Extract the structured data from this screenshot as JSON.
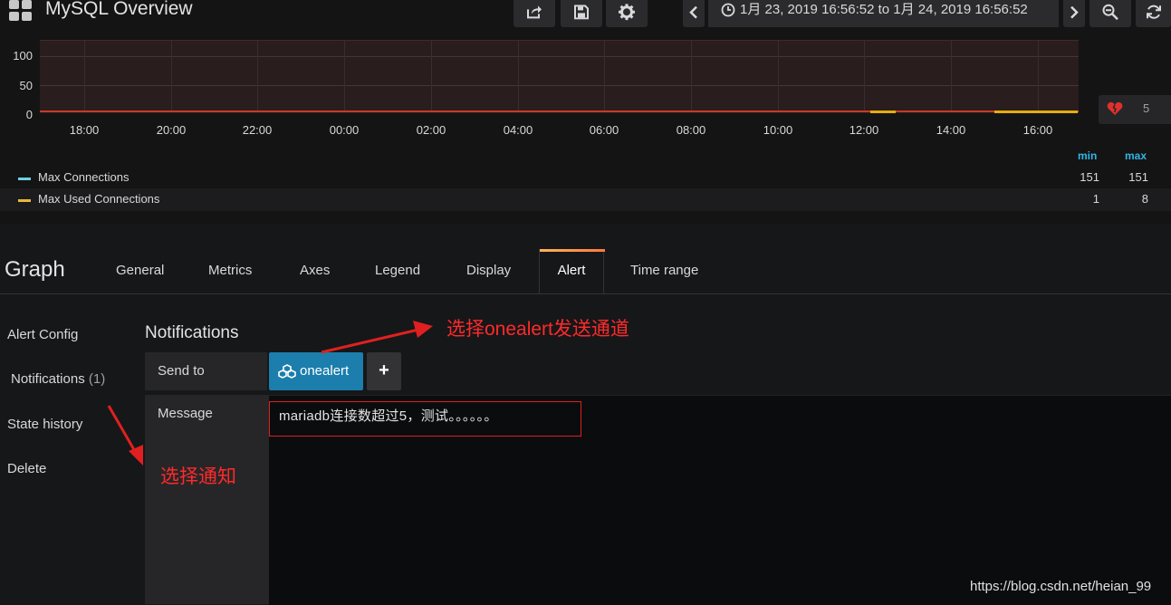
{
  "navbar": {
    "title": "MySQL Overview",
    "time_range": "1月 23, 2019 16:56:52 to 1月 24, 2019 16:56:52",
    "icons": [
      "dashboard-logo-icon",
      "share-icon",
      "save-icon",
      "settings-icon",
      "chevron-left-icon",
      "clock-icon",
      "chevron-right-icon",
      "zoom-out-icon",
      "refresh-icon"
    ]
  },
  "graph": {
    "y_ticks": [
      "100",
      "50",
      "0"
    ],
    "x_ticks": [
      "18:00",
      "20:00",
      "22:00",
      "00:00",
      "02:00",
      "04:00",
      "06:00",
      "08:00",
      "10:00",
      "12:00",
      "14:00",
      "16:00"
    ],
    "alert_value": "5",
    "threshold_color": "#c93a24",
    "legend_headers": {
      "min": "min",
      "max": "max"
    },
    "legend": [
      {
        "name": "Max Connections",
        "color": "#6ed0e0",
        "min": "151",
        "max": "151"
      },
      {
        "name": "Max Used Connections",
        "color": "#eab839",
        "min": "1",
        "max": "8"
      }
    ]
  },
  "chart_data": {
    "type": "line",
    "x": [
      "18:00",
      "20:00",
      "22:00",
      "00:00",
      "02:00",
      "04:00",
      "06:00",
      "08:00",
      "10:00",
      "12:00",
      "14:00",
      "16:00"
    ],
    "ylim": [
      0,
      100
    ],
    "series": [
      {
        "name": "Max Connections",
        "values": [
          151,
          151,
          151,
          151,
          151,
          151,
          151,
          151,
          151,
          151,
          151,
          151
        ]
      },
      {
        "name": "Max Used Connections",
        "values": [
          1,
          1,
          1,
          1,
          1,
          1,
          1,
          1,
          1,
          1,
          1,
          8
        ]
      }
    ]
  },
  "editor": {
    "title": "Graph",
    "tabs": [
      "General",
      "Metrics",
      "Axes",
      "Legend",
      "Display",
      "Alert",
      "Time range"
    ],
    "active_tab": "Alert"
  },
  "sidebar": {
    "items": [
      {
        "label": "Alert Config"
      },
      {
        "label": "Notifications",
        "count": "(1)"
      },
      {
        "label": "State history"
      },
      {
        "label": "Delete"
      }
    ]
  },
  "notifications": {
    "title": "Notifications",
    "send_to_label": "Send to",
    "channel": "onealert",
    "add_label": "+",
    "message_label": "Message",
    "message": "mariadb连接数超过5，测试。。。。。。"
  },
  "annotations": {
    "select_channel": "选择onealert发送通道",
    "select_notification": "选择通知"
  },
  "watermark": "https://blog.csdn.net/heian_99",
  "colors": {
    "accent": "#1b7eac",
    "annotation": "#ff2a2a",
    "tab_highlight": "#ff7941"
  }
}
